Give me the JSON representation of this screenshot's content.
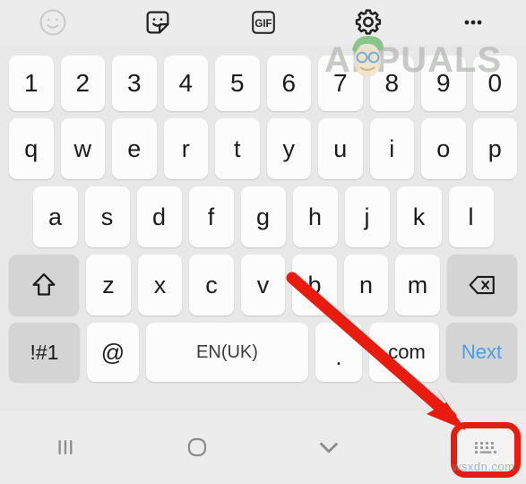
{
  "toolbar": {
    "items": [
      {
        "name": "emoji-icon",
        "label": "Emoji",
        "state": "inactive"
      },
      {
        "name": "sticker-icon",
        "label": "Sticker",
        "state": "active"
      },
      {
        "name": "gif-icon",
        "label": "GIF",
        "state": "active"
      },
      {
        "name": "settings-icon",
        "label": "Settings",
        "state": "active"
      },
      {
        "name": "more-icon",
        "label": "More",
        "state": "active"
      }
    ],
    "gif_label": "GIF"
  },
  "keyboard": {
    "row_numbers": [
      "1",
      "2",
      "3",
      "4",
      "5",
      "6",
      "7",
      "8",
      "9",
      "0"
    ],
    "row_top": [
      "q",
      "w",
      "e",
      "r",
      "t",
      "y",
      "u",
      "i",
      "o",
      "p"
    ],
    "row_home": [
      "a",
      "s",
      "d",
      "f",
      "g",
      "h",
      "j",
      "k",
      "l"
    ],
    "row_bottom": [
      "z",
      "x",
      "c",
      "v",
      "b",
      "n",
      "m"
    ],
    "shift_key": {
      "name": "shift-key",
      "label": "Shift"
    },
    "backspace_key": {
      "name": "backspace-key",
      "label": "Backspace"
    },
    "symbols_key": {
      "name": "symbols-key",
      "label": "!#1"
    },
    "at_key": {
      "name": "at-key",
      "label": "@"
    },
    "space_key": {
      "name": "space-key",
      "label": "EN(UK)"
    },
    "period_key": {
      "name": "period-key",
      "label": "."
    },
    "dotcom_key": {
      "name": "dotcom-key",
      "label": ".com"
    },
    "next_key": {
      "name": "next-key",
      "label": "Next"
    }
  },
  "navbar": {
    "recents_label": "Recents",
    "home_label": "Home",
    "hide_keyboard_label": "Hide keyboard",
    "keyboard_switch_label": "Change keyboard"
  },
  "annotation": {
    "arrow_color": "#e81b0e",
    "highlight_color": "#e81b0e",
    "points_to": "Change keyboard"
  },
  "watermark": {
    "brand": "APPUALS",
    "footer": "wsxdn.com"
  },
  "colors": {
    "background": "#ececec",
    "keyboard_background": "#e8e8e8",
    "key": "#fcfcfc",
    "function_key": "#d4d4d4",
    "key_text": "#1c1c1c",
    "next_text": "#4a9cf0",
    "accent_red": "#e81b0e"
  }
}
